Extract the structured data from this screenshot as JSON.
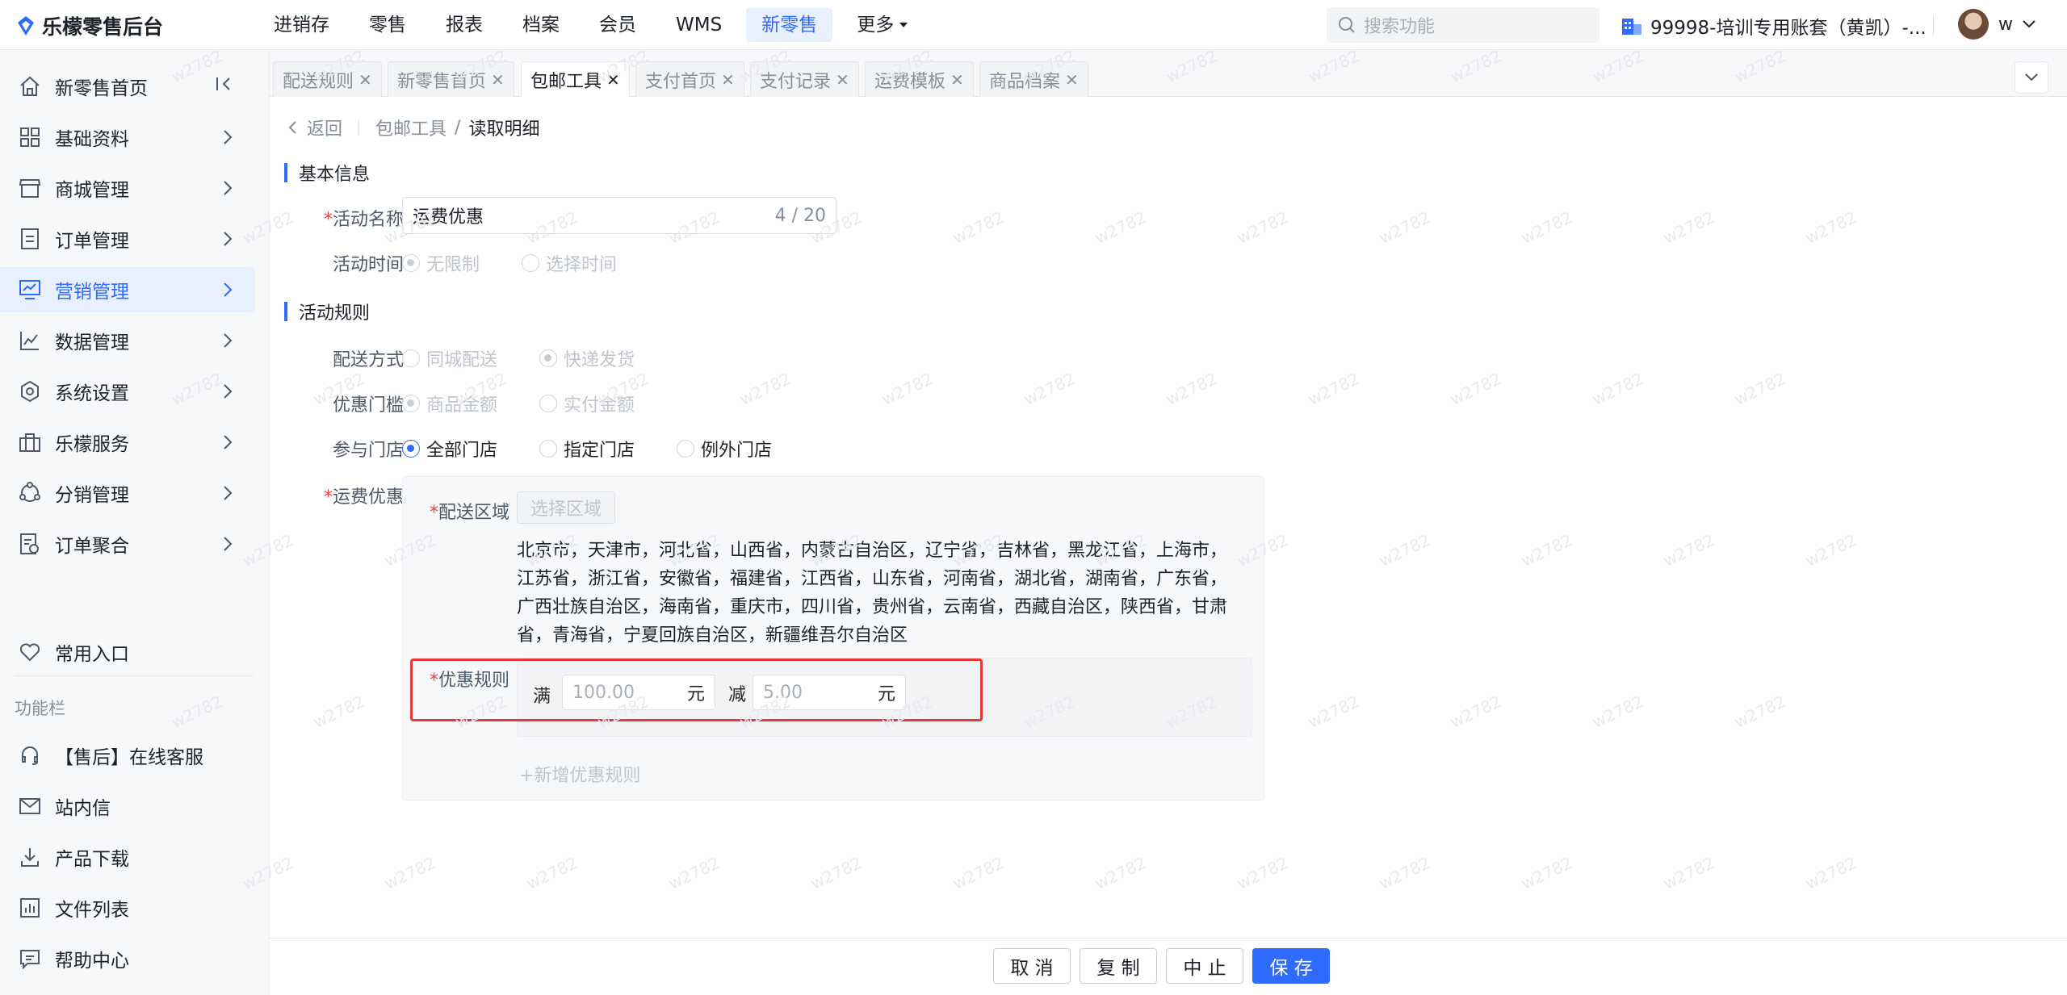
{
  "app": {
    "title": "乐檬零售后台"
  },
  "topnav": {
    "items": [
      "进销存",
      "零售",
      "报表",
      "档案",
      "会员",
      "WMS",
      "新零售"
    ],
    "more": "更多",
    "active_index": 6
  },
  "search": {
    "placeholder": "搜索功能"
  },
  "account": {
    "label": "99998-培训专用账套（黄凯）-..."
  },
  "user": {
    "name": "w"
  },
  "sidebar": {
    "items": [
      {
        "label": "新零售首页",
        "icon": "home-icon"
      },
      {
        "label": "基础资料",
        "icon": "grid-icon"
      },
      {
        "label": "商城管理",
        "icon": "shop-icon"
      },
      {
        "label": "订单管理",
        "icon": "order-icon"
      },
      {
        "label": "营销管理",
        "icon": "marketing-icon",
        "active": true
      },
      {
        "label": "数据管理",
        "icon": "chart-icon"
      },
      {
        "label": "系统设置",
        "icon": "settings-icon"
      },
      {
        "label": "乐檬服务",
        "icon": "service-icon"
      },
      {
        "label": "分销管理",
        "icon": "distribution-icon"
      },
      {
        "label": "订单聚合",
        "icon": "aggregate-icon"
      }
    ],
    "favorites": "常用入口",
    "tools_title": "功能栏",
    "tools": [
      {
        "label": "【售后】在线客服",
        "icon": "headset-icon"
      },
      {
        "label": "站内信",
        "icon": "mail-icon"
      },
      {
        "label": "产品下载",
        "icon": "download-icon"
      },
      {
        "label": "文件列表",
        "icon": "file-list-icon"
      },
      {
        "label": "帮助中心",
        "icon": "help-icon"
      }
    ]
  },
  "tabs": [
    {
      "label": "配送规则"
    },
    {
      "label": "新零售首页"
    },
    {
      "label": "包邮工具",
      "active": true
    },
    {
      "label": "支付首页"
    },
    {
      "label": "支付记录"
    },
    {
      "label": "运费模板"
    },
    {
      "label": "商品档案"
    }
  ],
  "breadcrumb": {
    "back": "返回",
    "parent": "包邮工具",
    "sep": "/",
    "current": "读取明细"
  },
  "basic": {
    "title": "基本信息",
    "name_label": "活动名称",
    "name_value": "运费优惠",
    "name_count": "4 / 20",
    "time_label": "活动时间",
    "time_options": [
      "无限制",
      "选择时间"
    ]
  },
  "rules": {
    "title": "活动规则",
    "delivery_label": "配送方式",
    "delivery_options": [
      "同城配送",
      "快递发货"
    ],
    "threshold_label": "优惠门槛",
    "threshold_options": [
      "商品金额",
      "实付金额"
    ],
    "stores_label": "参与门店",
    "stores_options": [
      "全部门店",
      "指定门店",
      "例外门店"
    ],
    "freight_label": "运费优惠",
    "area_label": "配送区域",
    "area_button": "选择区域",
    "regions_text": "北京市，天津市，河北省，山西省，内蒙古自治区，辽宁省，吉林省，黑龙江省，上海市，江苏省，浙江省，安徽省，福建省，江西省，山东省，河南省，湖北省，湖南省，广东省，广西壮族自治区，海南省，重庆市，四川省，贵州省，云南省，西藏自治区，陕西省，甘肃省，青海省，宁夏回族自治区，新疆维吾尔自治区",
    "discount_label": "优惠规则",
    "full_label": "满",
    "full_value": "100.00",
    "unit": "元",
    "minus_label": "减",
    "minus_value": "5.00",
    "add_rule": "+新增优惠规则"
  },
  "footer": {
    "cancel": "取 消",
    "copy": "复 制",
    "stop": "中 止",
    "save": "保 存"
  },
  "watermark": "w2782",
  "colors": {
    "primary": "#2f6bff",
    "required": "#f53f3f",
    "highlight": "#e53935"
  }
}
